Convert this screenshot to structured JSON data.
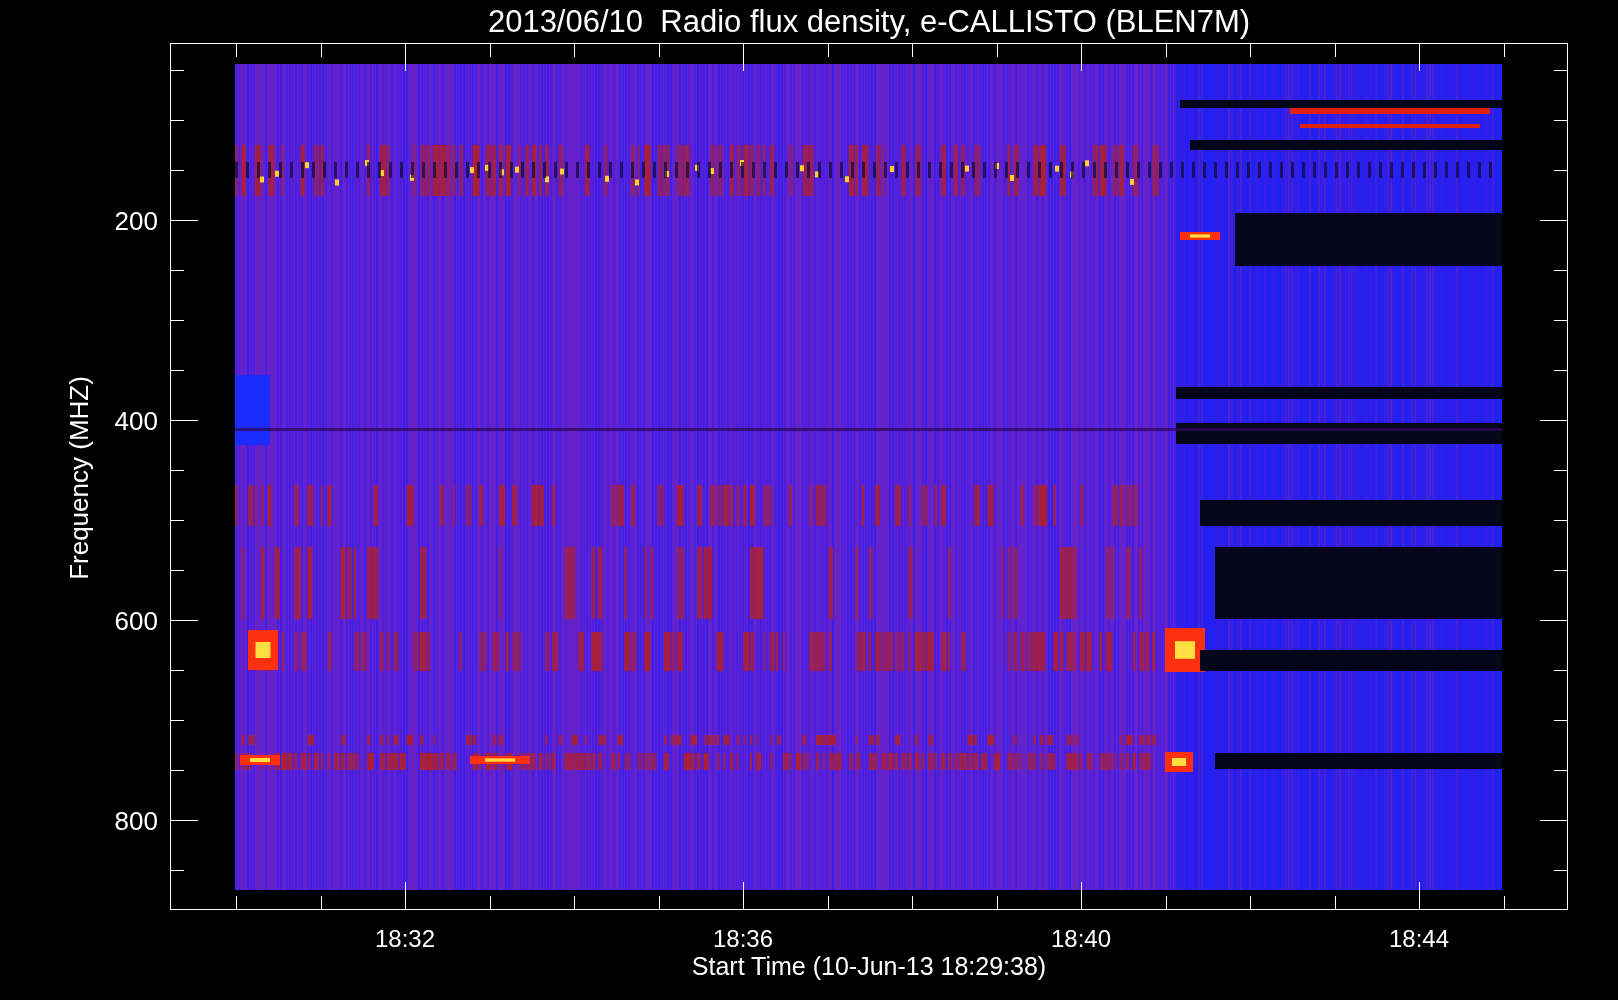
{
  "title": "2013/06/10  Radio flux density, e-CALLISTO (BLEN7M)",
  "y_axis": {
    "label": "Frequency (MHZ)",
    "ticks": [
      "200",
      "400",
      "600",
      "800"
    ]
  },
  "x_axis": {
    "label": "Start Time (10-Jun-13 18:29:38)",
    "ticks": [
      "18:32",
      "18:36",
      "18:40",
      "18:44"
    ]
  }
}
